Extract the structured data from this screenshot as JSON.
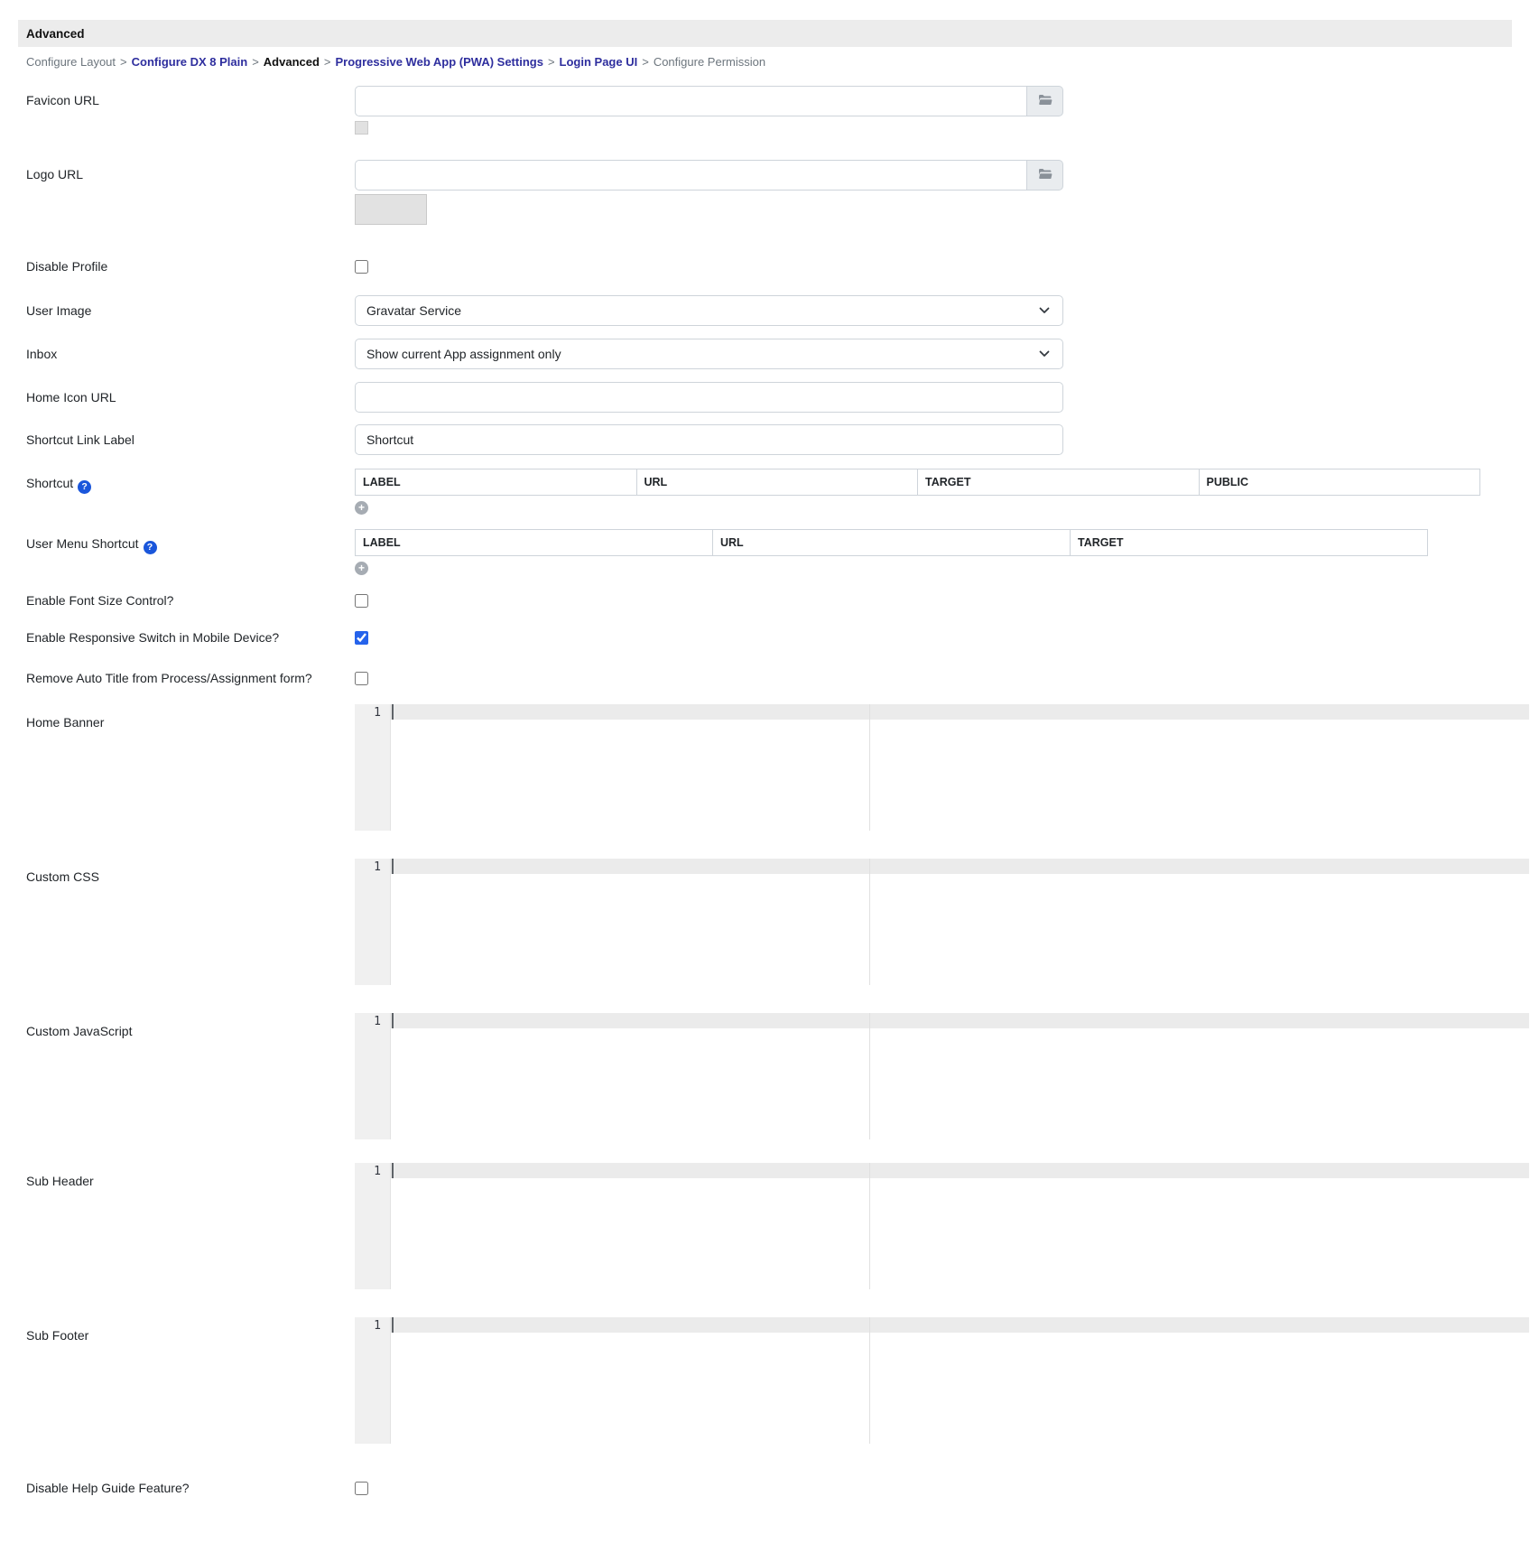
{
  "title_bar": {
    "title": "Advanced"
  },
  "breadcrumb": {
    "separator": ">",
    "items": [
      {
        "label": "Configure Layout",
        "style": "plain"
      },
      {
        "label": "Configure DX 8 Plain",
        "style": "link"
      },
      {
        "label": "Advanced",
        "style": "current"
      },
      {
        "label": "Progressive Web App (PWA) Settings",
        "style": "link"
      },
      {
        "label": "Login Page UI",
        "style": "link"
      },
      {
        "label": "Configure Permission",
        "style": "plain"
      }
    ]
  },
  "fields": {
    "favicon_url": {
      "label": "Favicon URL",
      "value": ""
    },
    "logo_url": {
      "label": "Logo URL",
      "value": ""
    },
    "disable_profile": {
      "label": "Disable Profile",
      "checked": false
    },
    "user_image": {
      "label": "User Image",
      "selected": "Gravatar Service"
    },
    "inbox": {
      "label": "Inbox",
      "selected": "Show current App assignment only"
    },
    "home_icon_url": {
      "label": "Home Icon URL",
      "value": ""
    },
    "shortcut_link_label": {
      "label": "Shortcut Link Label",
      "value": "Shortcut"
    },
    "shortcut": {
      "label": "Shortcut",
      "columns": [
        "LABEL",
        "URL",
        "TARGET",
        "PUBLIC"
      ],
      "rows": []
    },
    "user_menu_shortcut": {
      "label": "User Menu Shortcut",
      "columns": [
        "LABEL",
        "URL",
        "TARGET"
      ],
      "rows": []
    },
    "enable_font_size_control": {
      "label": "Enable Font Size Control?",
      "checked": false
    },
    "enable_responsive_switch": {
      "label": "Enable Responsive Switch in Mobile Device?",
      "checked": true
    },
    "remove_auto_title": {
      "label": "Remove Auto Title from Process/Assignment form?",
      "checked": false
    },
    "home_banner": {
      "label": "Home Banner",
      "line_number": "1",
      "content": ""
    },
    "custom_css": {
      "label": "Custom CSS",
      "line_number": "1",
      "content": ""
    },
    "custom_javascript": {
      "label": "Custom JavaScript",
      "line_number": "1",
      "content": ""
    },
    "sub_header": {
      "label": "Sub Header",
      "line_number": "1",
      "content": ""
    },
    "sub_footer": {
      "label": "Sub Footer",
      "line_number": "1",
      "content": ""
    },
    "disable_help_guide": {
      "label": "Disable Help Guide Feature?",
      "checked": false
    }
  },
  "icons": {
    "browse": "folder-open-icon",
    "help": "question-circle-icon",
    "add_row": "plus-circle-icon",
    "select_arrow": "chevron-down-icon"
  },
  "colors": {
    "title_bar_bg": "#ececec",
    "breadcrumb_link": "#2e2e9e",
    "help_icon_blue": "#1a56db",
    "checkbox_checked_blue": "#2563eb",
    "input_border": "#ced4da",
    "editor_gutter_bg": "#f0f0f0",
    "editor_active_line": "#ebebeb"
  }
}
